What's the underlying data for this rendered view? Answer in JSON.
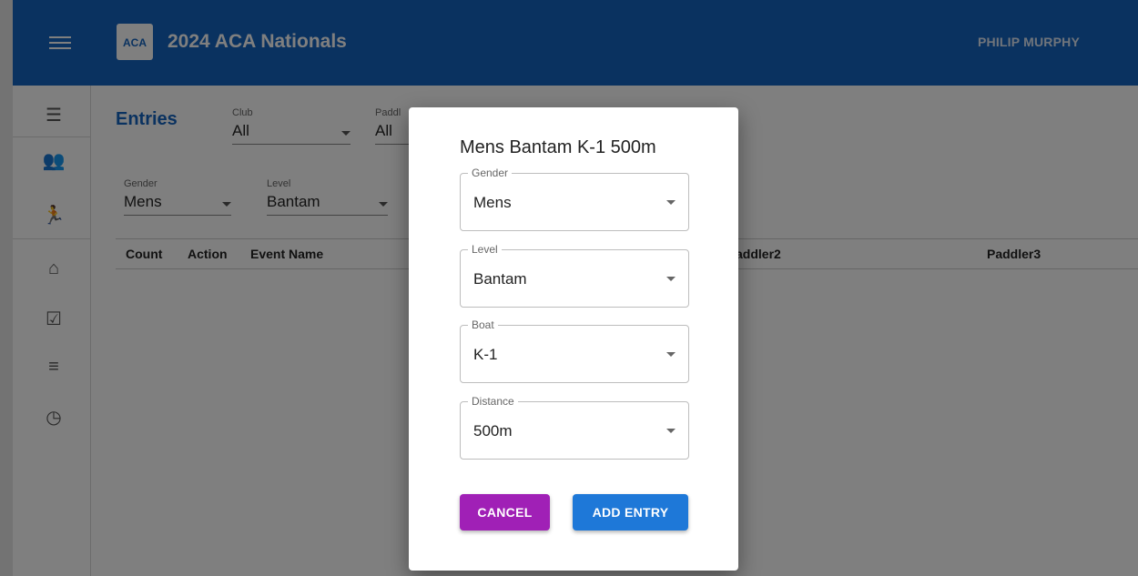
{
  "app": {
    "title": "2024 ACA Nationals",
    "logo_text": "ACA",
    "user_name": "PHILIP MURPHY"
  },
  "entries": {
    "title": "Entries",
    "filters": [
      {
        "label": "Club",
        "value": "All"
      },
      {
        "label": "Paddl",
        "value": "All"
      },
      {
        "label": "Gender",
        "value": "Mens"
      },
      {
        "label": "Level",
        "value": "Bantam"
      }
    ],
    "columns": [
      "Count",
      "Action",
      "Event Name",
      "addler2",
      "Paddler3"
    ]
  },
  "dialog": {
    "title": "Mens Bantam K-1 500m",
    "fields": [
      {
        "label": "Gender",
        "value": "Mens"
      },
      {
        "label": "Level",
        "value": "Bantam"
      },
      {
        "label": "Boat",
        "value": "K-1"
      },
      {
        "label": "Distance",
        "value": "500m"
      }
    ],
    "cancel_label": "CANCEL",
    "add_label": "ADD ENTRY"
  },
  "colors": {
    "appbar": "#1565c0",
    "cancel": "#a020b6",
    "add": "#1e78d8"
  }
}
